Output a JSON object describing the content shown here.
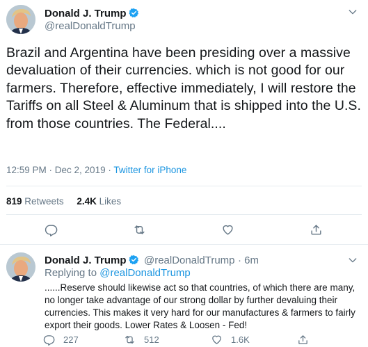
{
  "main_tweet": {
    "author_name": "Donald J. Trump",
    "author_handle": "@realDonaldTrump",
    "text": "Brazil and Argentina have been presiding over a massive devaluation of their currencies. which is not good for our farmers. Therefore, effective immediately, I will restore the Tariffs on all Steel & Aluminum that is shipped into the U.S. from those countries. The Federal....",
    "time": "12:59 PM · Dec 2, 2019",
    "separator": "·",
    "source": "Twitter for iPhone",
    "retweets_count": "819",
    "retweets_label": "Retweets",
    "likes_count": "2.4K",
    "likes_label": "Likes"
  },
  "reply_tweet": {
    "author_name": "Donald J. Trump",
    "author_handle": "@realDonaldTrump",
    "age": "· 6m",
    "replying_to_label": "Replying to",
    "replying_to_handle": "@realDonaldTrump",
    "text": "......Reserve should likewise act so that countries, of which there are many, no longer take advantage of our strong dollar by further devaluing their currencies. This makes it very hard for our manufactures & farmers to fairly export their goods. Lower Rates & Loosen - Fed!",
    "reply_count": "227",
    "retweet_count": "512",
    "like_count": "1.6K"
  },
  "colors": {
    "accent": "#1b95e0",
    "muted": "#657786",
    "verified": "#1da1f2",
    "divider": "#e6ecf0"
  },
  "icons": [
    "chevron-down-icon",
    "verified-badge-icon",
    "reply-icon",
    "retweet-icon",
    "like-icon",
    "share-icon"
  ]
}
